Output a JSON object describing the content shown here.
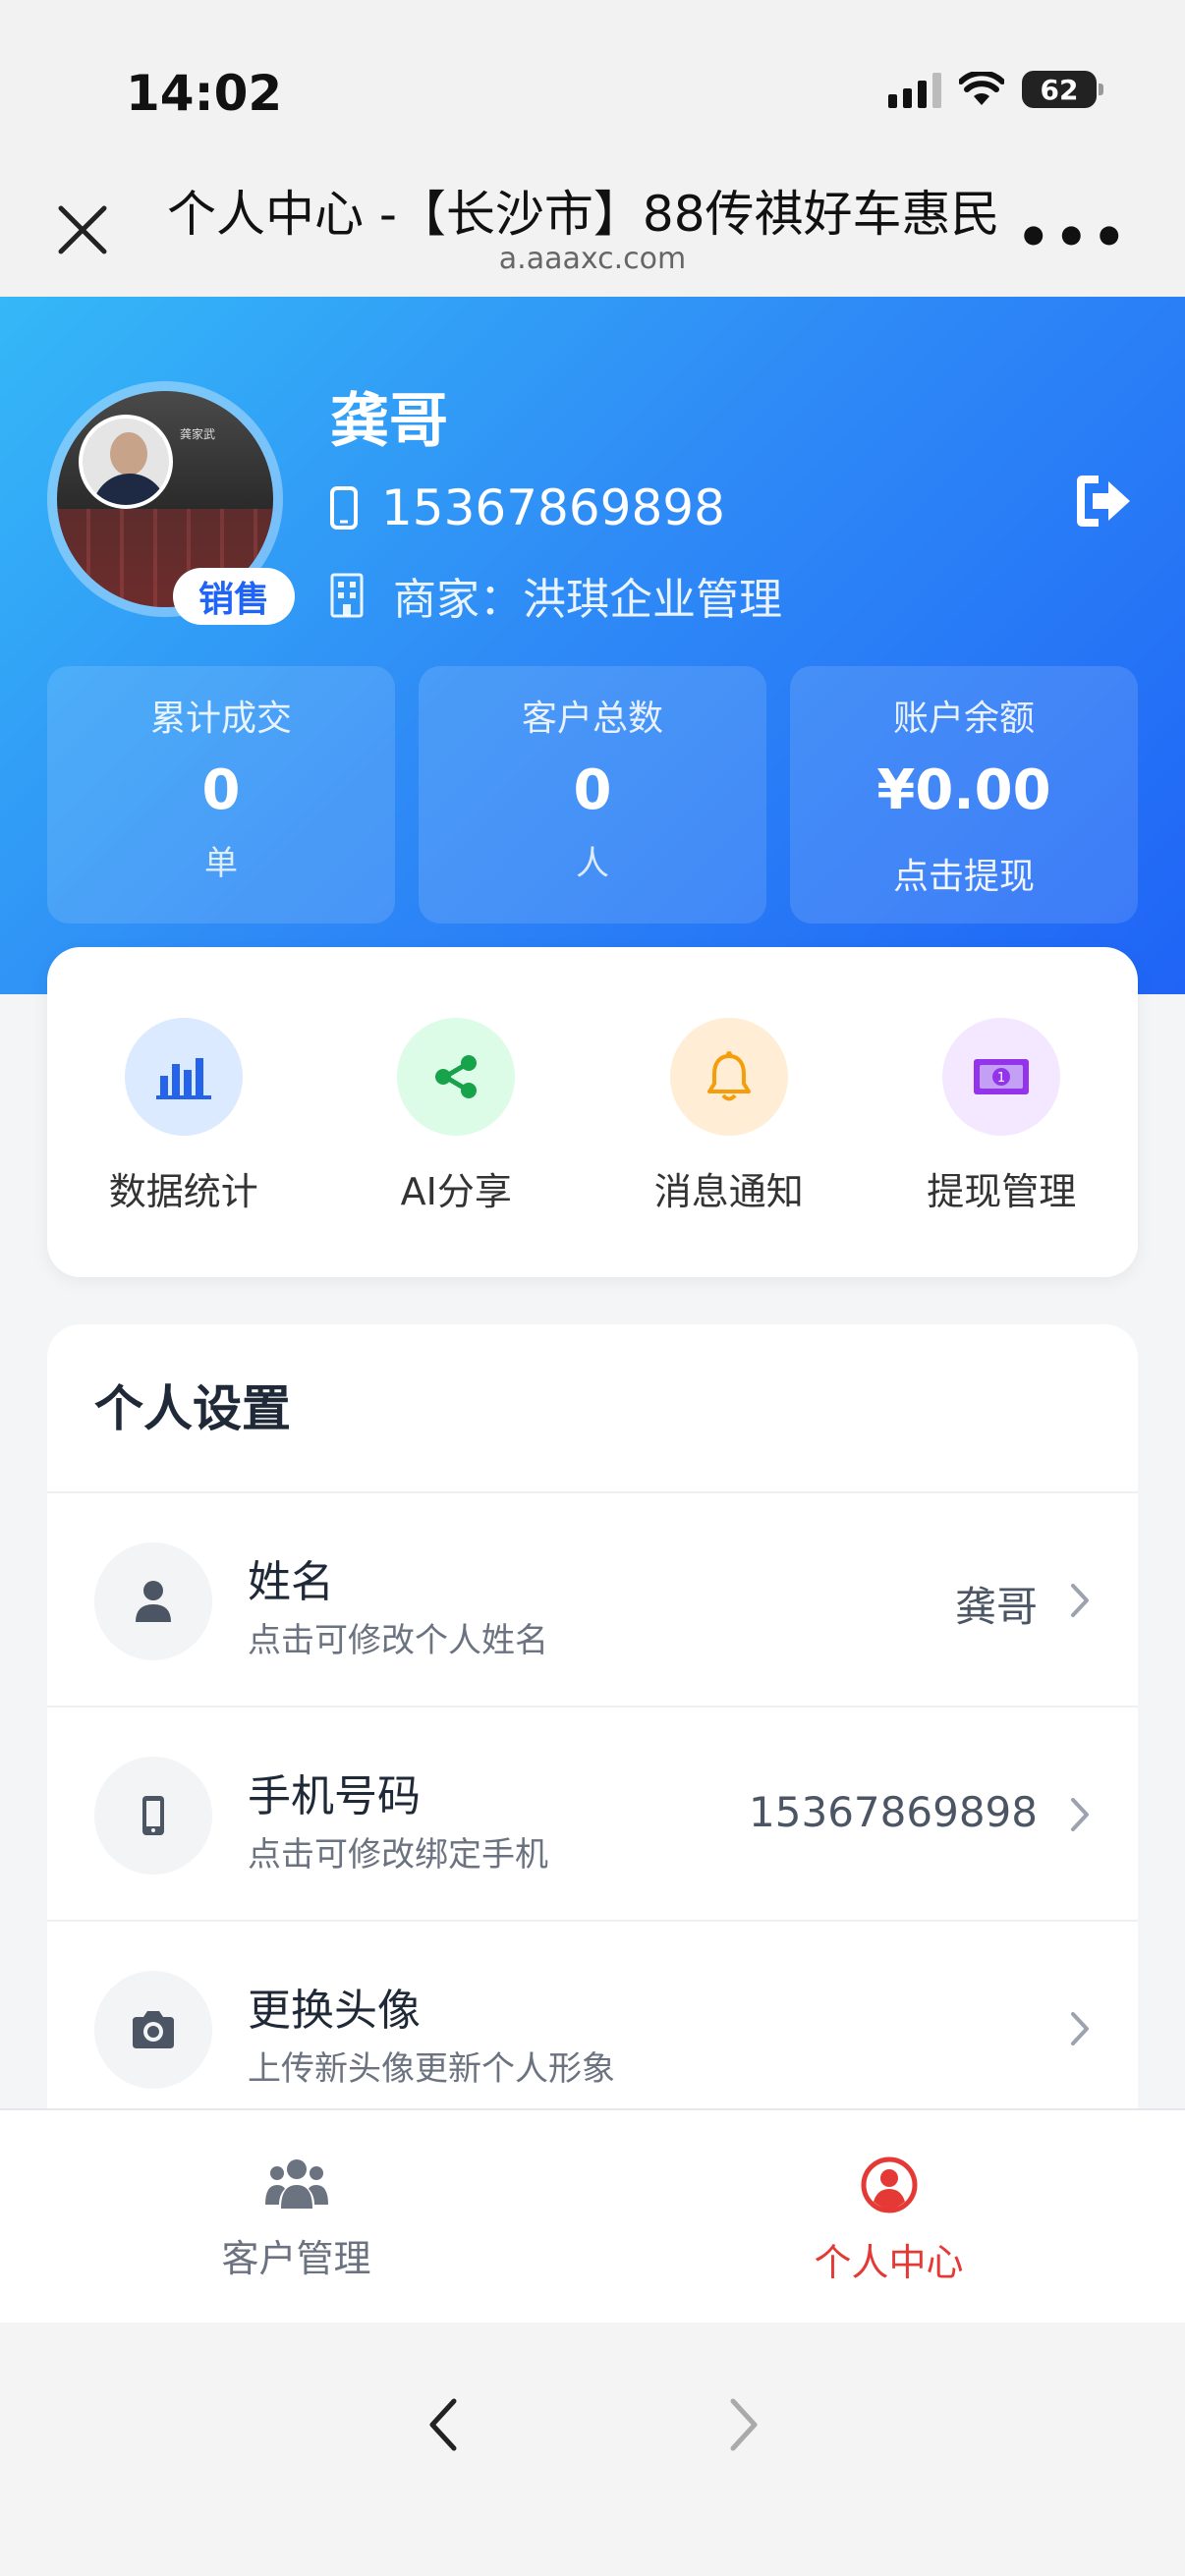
{
  "status_bar": {
    "time": "14:02",
    "battery": "62"
  },
  "browser": {
    "title": "个人中心 -【长沙市】88传祺好车惠民",
    "url": "a.aaaxc.com"
  },
  "profile": {
    "name": "龚哥",
    "phone": "15367869898",
    "merchant": "商家：洪琪企业管理",
    "role": "销售",
    "avatar_card_text": "龚家武"
  },
  "stats": [
    {
      "label": "累计成交",
      "value": "0",
      "unit": "单"
    },
    {
      "label": "客户总数",
      "value": "0",
      "unit": "人"
    },
    {
      "label": "账户余额",
      "value": "¥0.00",
      "link": "点击提现"
    }
  ],
  "quick_actions": [
    {
      "label": "数据统计",
      "icon": "bar-chart-icon",
      "color": "#2563eb",
      "bg": "#dbeafe"
    },
    {
      "label": "AI分享",
      "icon": "share-icon",
      "color": "#16a34a",
      "bg": "#dcfce7"
    },
    {
      "label": "消息通知",
      "icon": "bell-icon",
      "color": "#f59e0b",
      "bg": "#ffedd5"
    },
    {
      "label": "提现管理",
      "icon": "money-icon",
      "color": "#9333ea",
      "bg": "#f3e8ff"
    }
  ],
  "settings": {
    "title": "个人设置",
    "rows": [
      {
        "title": "姓名",
        "subtitle": "点击可修改个人姓名",
        "value": "龚哥",
        "icon": "user-icon"
      },
      {
        "title": "手机号码",
        "subtitle": "点击可修改绑定手机",
        "value": "15367869898",
        "icon": "mobile-icon"
      },
      {
        "title": "更换头像",
        "subtitle": "上传新头像更新个人形象",
        "value": "",
        "icon": "camera-icon"
      }
    ]
  },
  "tab_bar": {
    "tabs": [
      {
        "label": "客户管理",
        "icon": "users-icon",
        "active": false
      },
      {
        "label": "个人中心",
        "icon": "profile-icon",
        "active": true
      }
    ],
    "active_color": "#e53935"
  },
  "colors": {
    "header_start": "#35b8f7",
    "header_end": "#1f64f6"
  }
}
